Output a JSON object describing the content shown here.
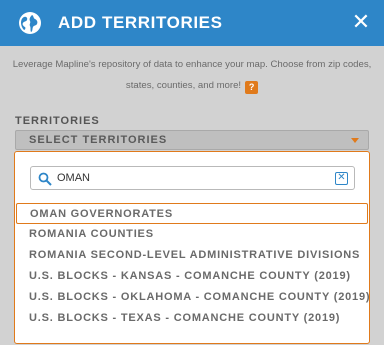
{
  "header": {
    "title": "ADD TERRITORIES",
    "close_symbol": "✕",
    "icon": "globe-icon",
    "color": "#2e86c8"
  },
  "intro": {
    "line1": "Leverage Mapline's repository of data to enhance your map. Choose from zip codes,",
    "line2": "states, counties, and more!",
    "help_label": "?"
  },
  "territories": {
    "label": "TERRITORIES",
    "select_label": "SELECT TERRITORIES"
  },
  "search": {
    "value": "OMAN",
    "clear_symbol": "✕"
  },
  "options": [
    "OMAN GOVERNORATES",
    "ROMANIA COUNTIES",
    "ROMANIA SECOND-LEVEL ADMINISTRATIVE DIVISIONS",
    "U.S. BLOCKS - KANSAS - COMANCHE COUNTY (2019)",
    "U.S. BLOCKS - OKLAHOMA - COMANCHE COUNTY (2019)",
    "U.S. BLOCKS - TEXAS - COMANCHE COUNTY (2019)"
  ],
  "accent_color": "#e07a1b"
}
